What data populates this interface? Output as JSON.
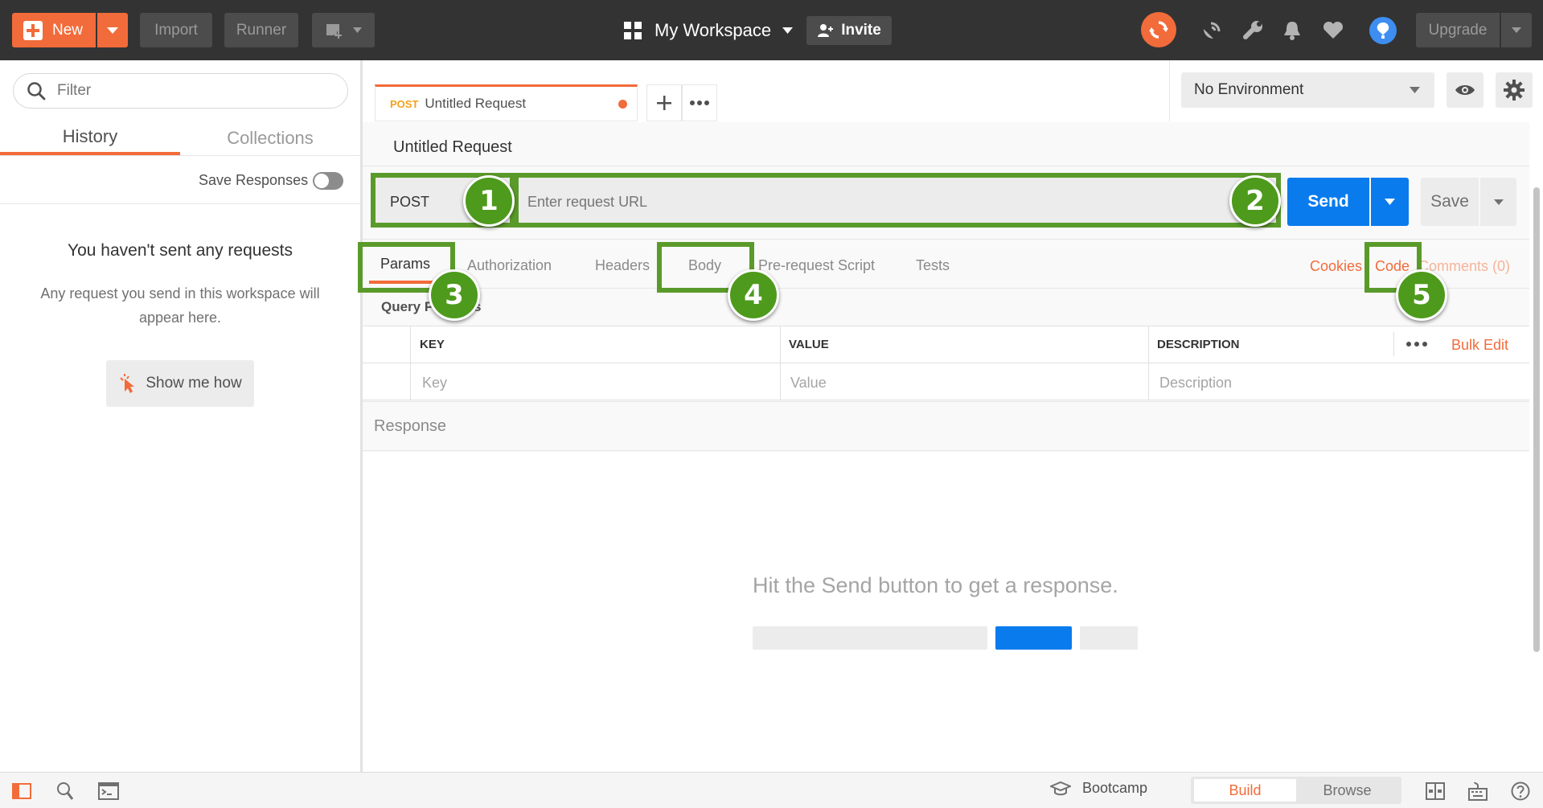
{
  "topbar": {
    "new_label": "New",
    "import_label": "Import",
    "runner_label": "Runner",
    "workspace_label": "My Workspace",
    "invite_label": "Invite",
    "upgrade_label": "Upgrade"
  },
  "sidebar": {
    "filter_placeholder": "Filter",
    "tabs": [
      {
        "label": "History",
        "active": true
      },
      {
        "label": "Collections",
        "active": false
      }
    ],
    "save_responses_label": "Save Responses",
    "empty_title": "You haven't sent any requests",
    "empty_text_line1": "Any request you send in this workspace will",
    "empty_text_line2": "appear here.",
    "show_me_how_label": "Show me how"
  },
  "tab_bar": {
    "tab_method": "POST",
    "tab_title": "Untitled Request"
  },
  "environment": {
    "selected": "No Environment"
  },
  "request": {
    "title": "Untitled Request",
    "method": "POST",
    "url_placeholder": "Enter request URL",
    "send_label": "Send",
    "save_label": "Save"
  },
  "request_tabs": {
    "items": [
      {
        "label": "Params",
        "active": true
      },
      {
        "label": "Authorization"
      },
      {
        "label": "Headers"
      },
      {
        "label": "Body"
      },
      {
        "label": "Pre-request Script"
      },
      {
        "label": "Tests"
      }
    ],
    "cookies_label": "Cookies",
    "code_label": "Code",
    "comments_label": "Comments (0)"
  },
  "params": {
    "section_title_a": "Query P",
    "section_title_b": "s",
    "columns": {
      "key": "KEY",
      "value": "VALUE",
      "description": "DESCRIPTION"
    },
    "bulk_edit_label": "Bulk Edit",
    "placeholders": {
      "key": "Key",
      "value": "Value",
      "description": "Description"
    }
  },
  "response": {
    "title": "Response",
    "hint": "Hit the Send button to get a response."
  },
  "bottombar": {
    "bootcamp_label": "Bootcamp",
    "build_label": "Build",
    "browse_label": "Browse"
  },
  "annotations": [
    "1",
    "2",
    "3",
    "4",
    "5"
  ],
  "colors": {
    "accent": "#f26b3a",
    "send_blue": "#097bed",
    "annotation_green": "#5a9a2a",
    "topbar": "#333333"
  }
}
